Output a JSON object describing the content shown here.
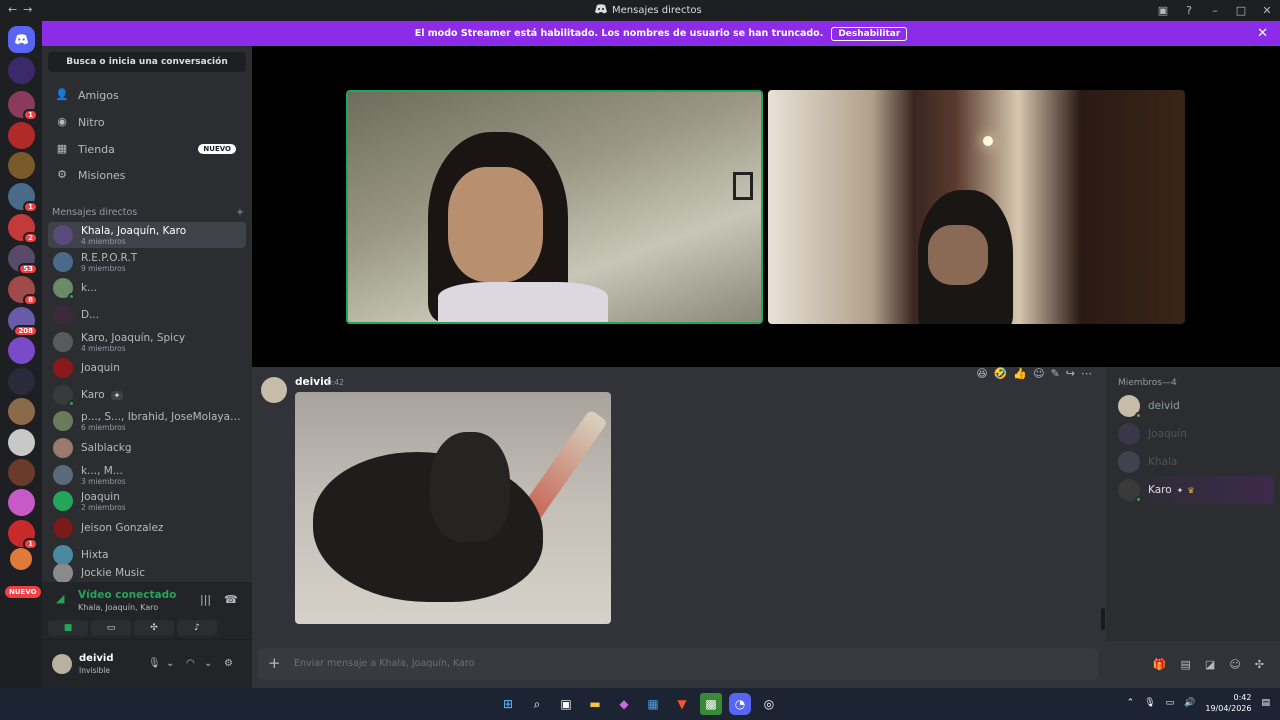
{
  "titlebar": {
    "title": "Mensajes directos"
  },
  "banner": {
    "text": "El modo Streamer está habilitado. Los nombres de usuario se han truncado.",
    "button": "Deshabilitar"
  },
  "guilds": {
    "badges": [
      "1",
      "2",
      "1",
      "53",
      "8",
      "208",
      "1"
    ],
    "nuevo": "NUEVO"
  },
  "sidebar": {
    "search": "Busca o inicia una conversación",
    "nav": [
      {
        "label": "Amigos",
        "icon": "friends-icon"
      },
      {
        "label": "Nitro",
        "icon": "nitro-icon"
      },
      {
        "label": "Tienda",
        "icon": "shop-icon",
        "badge": "NUEVO"
      },
      {
        "label": "Misiones",
        "icon": "quests-icon"
      }
    ],
    "section": "Mensajes directos",
    "dms": [
      {
        "name": "Khala, Joaquín, Karo",
        "sub": "4 miembros"
      },
      {
        "name": "R.E.P.O.R.T",
        "sub": "9 miembros"
      },
      {
        "name": "k...",
        "sub": ""
      },
      {
        "name": "D...",
        "sub": ""
      },
      {
        "name": "Karo, Joaquín, Spicy",
        "sub": "4 miembros"
      },
      {
        "name": "Joaquin",
        "sub": ""
      },
      {
        "name": "Karo",
        "sub": ""
      },
      {
        "name": "p..., S..., Ibrahid, JoseMolaya, Jud...",
        "sub": "6 miembros"
      },
      {
        "name": "Salblackg",
        "sub": ""
      },
      {
        "name": "k..., M...",
        "sub": "3 miembros"
      },
      {
        "name": "Joaquin",
        "sub": "2 miembros"
      },
      {
        "name": "Jeison Gonzalez",
        "sub": ""
      },
      {
        "name": "Hixta",
        "sub": ""
      },
      {
        "name": "Jockie Music",
        "sub": ""
      }
    ]
  },
  "voice": {
    "title": "Vídeo conectado",
    "sub": "Khala, Joaquín, Karo"
  },
  "user": {
    "name": "deivid",
    "status": "Invisible"
  },
  "message": {
    "author": "deivid",
    "time": "0:42"
  },
  "composer": {
    "placeholder": "Enviar mensaje a Khala, Joaquín, Karo"
  },
  "members": {
    "header": "Miembros—4",
    "list": [
      {
        "name": "deivid"
      },
      {
        "name": "Joaquín"
      },
      {
        "name": "Khala"
      },
      {
        "name": "Karo"
      }
    ]
  },
  "taskbar": {
    "time": "0:42",
    "date": "19/04/2026"
  },
  "colors": {
    "accent": "#5865f2",
    "streamer": "#8c2ce8",
    "online": "#23a55a",
    "danger": "#f23f43"
  }
}
